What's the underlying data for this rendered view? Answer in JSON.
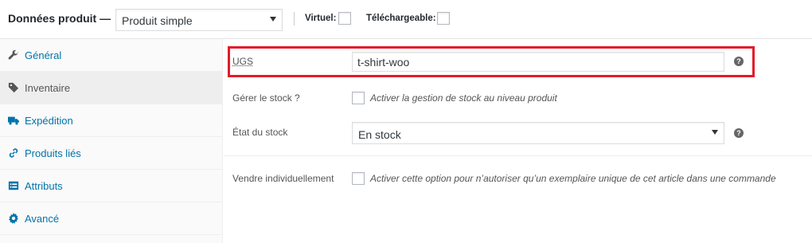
{
  "header": {
    "title": "Données produit —",
    "product_type": "Produit simple",
    "virtual_label": "Virtuel:",
    "downloadable_label": "Téléchargeable:"
  },
  "sidebar": {
    "items": [
      {
        "label": "Général",
        "icon": "wrench-icon"
      },
      {
        "label": "Inventaire",
        "icon": "tag-icon",
        "active": true
      },
      {
        "label": "Expédition",
        "icon": "truck-icon"
      },
      {
        "label": "Produits liés",
        "icon": "link-icon"
      },
      {
        "label": "Attributs",
        "icon": "list-icon"
      },
      {
        "label": "Avancé",
        "icon": "gear-icon"
      }
    ]
  },
  "inventory": {
    "sku_label": "UGS",
    "sku_value": "t-shirt-woo",
    "manage_stock_label": "Gérer le stock ?",
    "manage_stock_desc": "Activer la gestion de stock au niveau produit",
    "stock_status_label": "État du stock",
    "stock_status_value": "En stock",
    "sold_individually_label": "Vendre individuellement",
    "sold_individually_desc": "Activer cette option pour n’autoriser qu’un exemplaire unique de cet article dans une commande",
    "help_glyph": "?"
  },
  "colors": {
    "link": "#0073aa",
    "highlight": "#e11b2a",
    "sidebar_bg": "#fafafa",
    "active_tab_bg": "#eeeeee"
  }
}
